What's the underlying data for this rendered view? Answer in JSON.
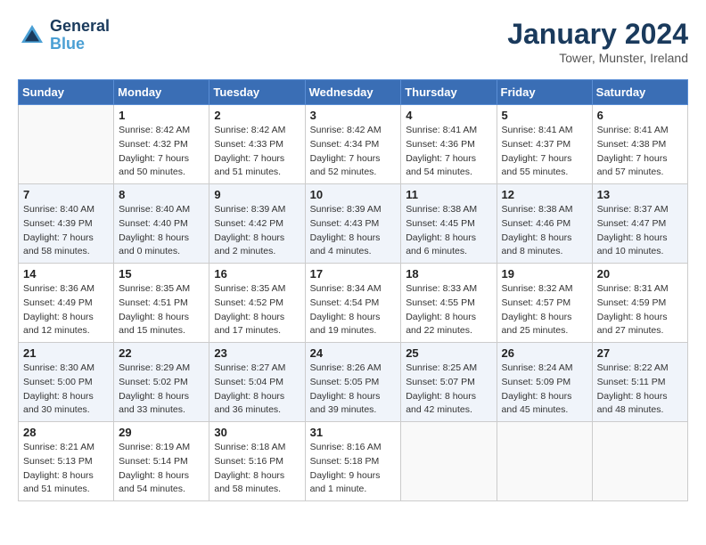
{
  "header": {
    "logo_text_general": "General",
    "logo_text_blue": "Blue",
    "month_title": "January 2024",
    "location": "Tower, Munster, Ireland"
  },
  "weekdays": [
    "Sunday",
    "Monday",
    "Tuesday",
    "Wednesday",
    "Thursday",
    "Friday",
    "Saturday"
  ],
  "weeks": [
    [
      {
        "day": "",
        "sunrise": "",
        "sunset": "",
        "daylight": ""
      },
      {
        "day": "1",
        "sunrise": "Sunrise: 8:42 AM",
        "sunset": "Sunset: 4:32 PM",
        "daylight": "Daylight: 7 hours and 50 minutes."
      },
      {
        "day": "2",
        "sunrise": "Sunrise: 8:42 AM",
        "sunset": "Sunset: 4:33 PM",
        "daylight": "Daylight: 7 hours and 51 minutes."
      },
      {
        "day": "3",
        "sunrise": "Sunrise: 8:42 AM",
        "sunset": "Sunset: 4:34 PM",
        "daylight": "Daylight: 7 hours and 52 minutes."
      },
      {
        "day": "4",
        "sunrise": "Sunrise: 8:41 AM",
        "sunset": "Sunset: 4:36 PM",
        "daylight": "Daylight: 7 hours and 54 minutes."
      },
      {
        "day": "5",
        "sunrise": "Sunrise: 8:41 AM",
        "sunset": "Sunset: 4:37 PM",
        "daylight": "Daylight: 7 hours and 55 minutes."
      },
      {
        "day": "6",
        "sunrise": "Sunrise: 8:41 AM",
        "sunset": "Sunset: 4:38 PM",
        "daylight": "Daylight: 7 hours and 57 minutes."
      }
    ],
    [
      {
        "day": "7",
        "sunrise": "Sunrise: 8:40 AM",
        "sunset": "Sunset: 4:39 PM",
        "daylight": "Daylight: 7 hours and 58 minutes."
      },
      {
        "day": "8",
        "sunrise": "Sunrise: 8:40 AM",
        "sunset": "Sunset: 4:40 PM",
        "daylight": "Daylight: 8 hours and 0 minutes."
      },
      {
        "day": "9",
        "sunrise": "Sunrise: 8:39 AM",
        "sunset": "Sunset: 4:42 PM",
        "daylight": "Daylight: 8 hours and 2 minutes."
      },
      {
        "day": "10",
        "sunrise": "Sunrise: 8:39 AM",
        "sunset": "Sunset: 4:43 PM",
        "daylight": "Daylight: 8 hours and 4 minutes."
      },
      {
        "day": "11",
        "sunrise": "Sunrise: 8:38 AM",
        "sunset": "Sunset: 4:45 PM",
        "daylight": "Daylight: 8 hours and 6 minutes."
      },
      {
        "day": "12",
        "sunrise": "Sunrise: 8:38 AM",
        "sunset": "Sunset: 4:46 PM",
        "daylight": "Daylight: 8 hours and 8 minutes."
      },
      {
        "day": "13",
        "sunrise": "Sunrise: 8:37 AM",
        "sunset": "Sunset: 4:47 PM",
        "daylight": "Daylight: 8 hours and 10 minutes."
      }
    ],
    [
      {
        "day": "14",
        "sunrise": "Sunrise: 8:36 AM",
        "sunset": "Sunset: 4:49 PM",
        "daylight": "Daylight: 8 hours and 12 minutes."
      },
      {
        "day": "15",
        "sunrise": "Sunrise: 8:35 AM",
        "sunset": "Sunset: 4:51 PM",
        "daylight": "Daylight: 8 hours and 15 minutes."
      },
      {
        "day": "16",
        "sunrise": "Sunrise: 8:35 AM",
        "sunset": "Sunset: 4:52 PM",
        "daylight": "Daylight: 8 hours and 17 minutes."
      },
      {
        "day": "17",
        "sunrise": "Sunrise: 8:34 AM",
        "sunset": "Sunset: 4:54 PM",
        "daylight": "Daylight: 8 hours and 19 minutes."
      },
      {
        "day": "18",
        "sunrise": "Sunrise: 8:33 AM",
        "sunset": "Sunset: 4:55 PM",
        "daylight": "Daylight: 8 hours and 22 minutes."
      },
      {
        "day": "19",
        "sunrise": "Sunrise: 8:32 AM",
        "sunset": "Sunset: 4:57 PM",
        "daylight": "Daylight: 8 hours and 25 minutes."
      },
      {
        "day": "20",
        "sunrise": "Sunrise: 8:31 AM",
        "sunset": "Sunset: 4:59 PM",
        "daylight": "Daylight: 8 hours and 27 minutes."
      }
    ],
    [
      {
        "day": "21",
        "sunrise": "Sunrise: 8:30 AM",
        "sunset": "Sunset: 5:00 PM",
        "daylight": "Daylight: 8 hours and 30 minutes."
      },
      {
        "day": "22",
        "sunrise": "Sunrise: 8:29 AM",
        "sunset": "Sunset: 5:02 PM",
        "daylight": "Daylight: 8 hours and 33 minutes."
      },
      {
        "day": "23",
        "sunrise": "Sunrise: 8:27 AM",
        "sunset": "Sunset: 5:04 PM",
        "daylight": "Daylight: 8 hours and 36 minutes."
      },
      {
        "day": "24",
        "sunrise": "Sunrise: 8:26 AM",
        "sunset": "Sunset: 5:05 PM",
        "daylight": "Daylight: 8 hours and 39 minutes."
      },
      {
        "day": "25",
        "sunrise": "Sunrise: 8:25 AM",
        "sunset": "Sunset: 5:07 PM",
        "daylight": "Daylight: 8 hours and 42 minutes."
      },
      {
        "day": "26",
        "sunrise": "Sunrise: 8:24 AM",
        "sunset": "Sunset: 5:09 PM",
        "daylight": "Daylight: 8 hours and 45 minutes."
      },
      {
        "day": "27",
        "sunrise": "Sunrise: 8:22 AM",
        "sunset": "Sunset: 5:11 PM",
        "daylight": "Daylight: 8 hours and 48 minutes."
      }
    ],
    [
      {
        "day": "28",
        "sunrise": "Sunrise: 8:21 AM",
        "sunset": "Sunset: 5:13 PM",
        "daylight": "Daylight: 8 hours and 51 minutes."
      },
      {
        "day": "29",
        "sunrise": "Sunrise: 8:19 AM",
        "sunset": "Sunset: 5:14 PM",
        "daylight": "Daylight: 8 hours and 54 minutes."
      },
      {
        "day": "30",
        "sunrise": "Sunrise: 8:18 AM",
        "sunset": "Sunset: 5:16 PM",
        "daylight": "Daylight: 8 hours and 58 minutes."
      },
      {
        "day": "31",
        "sunrise": "Sunrise: 8:16 AM",
        "sunset": "Sunset: 5:18 PM",
        "daylight": "Daylight: 9 hours and 1 minute."
      },
      {
        "day": "",
        "sunrise": "",
        "sunset": "",
        "daylight": ""
      },
      {
        "day": "",
        "sunrise": "",
        "sunset": "",
        "daylight": ""
      },
      {
        "day": "",
        "sunrise": "",
        "sunset": "",
        "daylight": ""
      }
    ]
  ]
}
